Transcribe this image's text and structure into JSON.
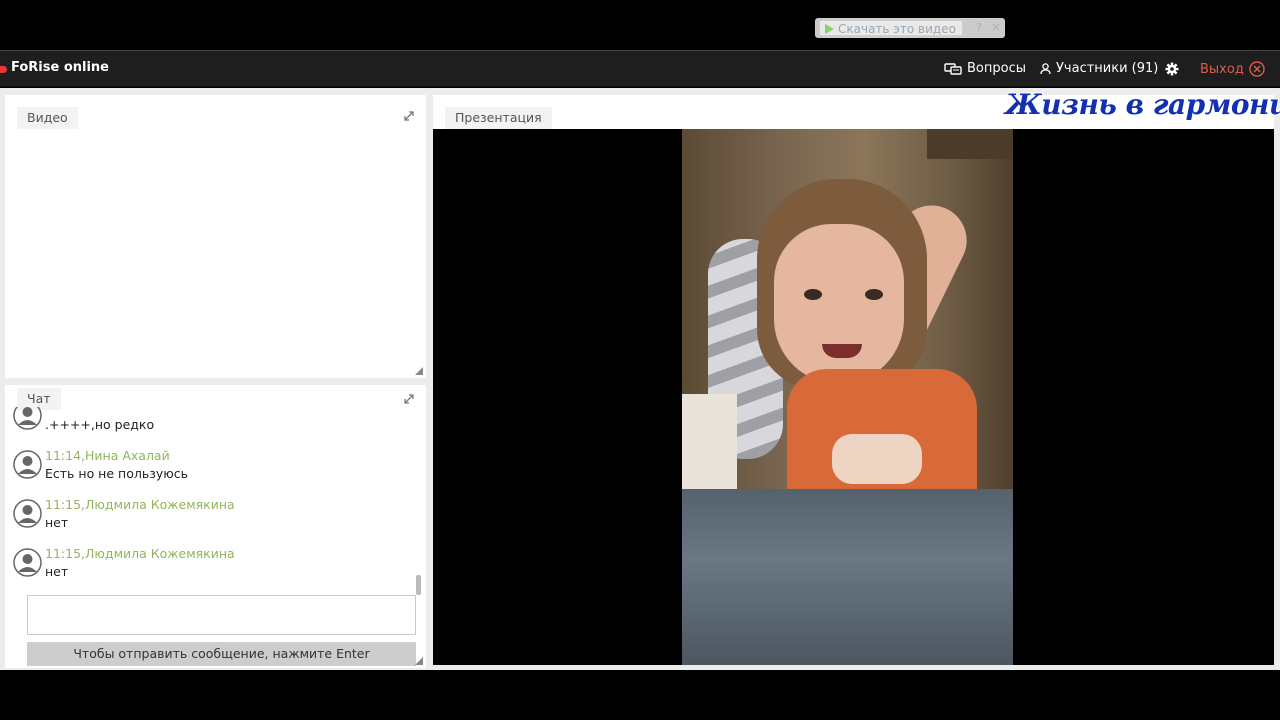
{
  "topbar": {
    "brand": "FoRise online",
    "questions_label": "Вопросы",
    "participants_label": "Участники (91)",
    "exit_label": "Выход"
  },
  "video_panel": {
    "tab_label": "Видео"
  },
  "chat_panel": {
    "tab_label": "Чат",
    "messages": [
      {
        "time": "",
        "author": "",
        "text": ".++++,но редко"
      },
      {
        "time": "11:14,",
        "author": "Нина Ахалай",
        "text": "Есть но не пользуюсь"
      },
      {
        "time": "11:15,",
        "author": "Людмила Кожемякина",
        "text": "нет"
      },
      {
        "time": "11:15,",
        "author": "Людмила Кожемякина",
        "text": "нет"
      }
    ],
    "input_value": "",
    "send_hint": "Чтобы отправить сообщение, нажмите Enter"
  },
  "presentation_panel": {
    "tab_label": "Презентация",
    "download_label": "Скачать это видео",
    "help_glyph": "?",
    "close_glyph": "×"
  },
  "watermark": "Жизнь в гармонии",
  "colors": {
    "topbar_bg": "#1e1e1e",
    "exit_red": "#e05a4e",
    "author_green": "#8fb55a",
    "watermark_blue": "#1330b0"
  }
}
